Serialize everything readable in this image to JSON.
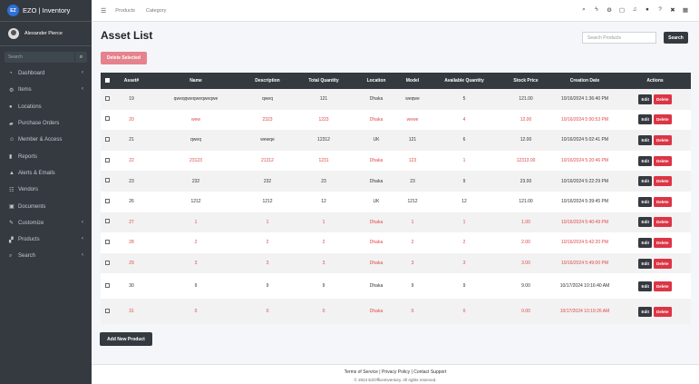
{
  "brand": {
    "logo": "EZ",
    "name": "EZO | Inventory"
  },
  "user": {
    "name": "Alexander Pierce"
  },
  "sidebar_search": {
    "placeholder": "Search"
  },
  "sidebar": {
    "items": [
      {
        "label": "Dashboard",
        "icon": "dashboard-icon",
        "glyph": "◔",
        "has_submenu": true
      },
      {
        "label": "Items",
        "icon": "items-icon",
        "glyph": "⚙",
        "has_submenu": true
      },
      {
        "label": "Locations",
        "icon": "location-pin-icon",
        "glyph": "●",
        "has_submenu": false
      },
      {
        "label": "Purchase Orders",
        "icon": "purchase-orders-icon",
        "glyph": "▰",
        "has_submenu": false
      },
      {
        "label": "Member & Access",
        "icon": "members-icon",
        "glyph": "☺",
        "has_submenu": false
      },
      {
        "label": "Reports",
        "icon": "reports-icon",
        "glyph": "▮",
        "has_submenu": false
      },
      {
        "label": "Alerts & Emails",
        "icon": "alert-icon",
        "glyph": "▲",
        "has_submenu": false
      },
      {
        "label": "Vendors",
        "icon": "vendors-icon",
        "glyph": "☷",
        "has_submenu": false
      },
      {
        "label": "Documents",
        "icon": "documents-icon",
        "glyph": "▣",
        "has_submenu": false
      },
      {
        "label": "Customize",
        "icon": "customize-icon",
        "glyph": "✎",
        "has_submenu": true
      },
      {
        "label": "Products",
        "icon": "products-icon",
        "glyph": "▞",
        "has_submenu": true
      },
      {
        "label": "Search",
        "icon": "search-icon",
        "glyph": "⌕",
        "has_submenu": true
      }
    ]
  },
  "topbar": {
    "links": [
      "Products",
      "Category"
    ]
  },
  "page": {
    "title": "Asset List",
    "search_placeholder": "Search Products",
    "search_button": "Search",
    "delete_selected": "Delete Selected",
    "add_new_product": "Add New Product"
  },
  "table": {
    "columns": [
      "Asset#",
      "Name",
      "Description",
      "Total Quantity",
      "Location",
      "Model",
      "Available Quantity",
      "Stock Price",
      "Creation Date",
      "Actions"
    ],
    "edit_label": "Edit",
    "delete_label": "Delete",
    "rows": [
      {
        "asset": "19",
        "name": "qweqqweqweqweqwe",
        "description": "qweq",
        "total_quantity": "121",
        "location": "Dhaka",
        "model": "weqwe",
        "available_quantity": "5",
        "stock_price": "121.00",
        "creation_date": "10/16/2024 1:36:40 PM",
        "highlight": false
      },
      {
        "asset": "20",
        "name": "wew",
        "description": "2323",
        "total_quantity": "1223",
        "location": "Dhaka",
        "model": "wewe",
        "available_quantity": "4",
        "stock_price": "12.00",
        "creation_date": "10/16/2024 5:00:53 PM",
        "highlight": true
      },
      {
        "asset": "21",
        "name": "qweq",
        "description": "wewqe",
        "total_quantity": "12312",
        "location": "UK",
        "model": "121",
        "available_quantity": "6",
        "stock_price": "12.00",
        "creation_date": "10/16/2024 5:02:41 PM",
        "highlight": false
      },
      {
        "asset": "22",
        "name": "23123",
        "description": "21312",
        "total_quantity": "1231",
        "location": "Dhaka",
        "model": "123",
        "available_quantity": "1",
        "stock_price": "12313.00",
        "creation_date": "10/16/2024 5:20:46 PM",
        "highlight": true
      },
      {
        "asset": "23",
        "name": "232",
        "description": "232",
        "total_quantity": "23",
        "location": "Dhaka",
        "model": "23",
        "available_quantity": "9",
        "stock_price": "23.00",
        "creation_date": "10/16/2024 5:22:29 PM",
        "highlight": false
      },
      {
        "asset": "26",
        "name": "1212",
        "description": "1212",
        "total_quantity": "12",
        "location": "UK",
        "model": "1212",
        "available_quantity": "12",
        "stock_price": "121.00",
        "creation_date": "10/16/2024 5:39:45 PM",
        "highlight": false
      },
      {
        "asset": "27",
        "name": "1",
        "description": "1",
        "total_quantity": "1",
        "location": "Dhaka",
        "model": "1",
        "available_quantity": "1",
        "stock_price": "1.00",
        "creation_date": "10/16/2024 5:40:49 PM",
        "highlight": true
      },
      {
        "asset": "28",
        "name": "2",
        "description": "2",
        "total_quantity": "2",
        "location": "Dhaka",
        "model": "2",
        "available_quantity": "2",
        "stock_price": "2.00",
        "creation_date": "10/16/2024 5:42:20 PM",
        "highlight": true
      },
      {
        "asset": "29",
        "name": "3",
        "description": "3",
        "total_quantity": "3",
        "location": "Dhaka",
        "model": "3",
        "available_quantity": "3",
        "stock_price": "3.00",
        "creation_date": "10/16/2024 5:49:00 PM",
        "highlight": true
      },
      {
        "asset": "30",
        "name": "9",
        "description": "9",
        "total_quantity": "9",
        "location": "Dhaka",
        "model": "9",
        "available_quantity": "9",
        "stock_price": "9.00",
        "creation_date": "10/17/2024 10:16:40 AM",
        "highlight": false
      },
      {
        "asset": "31",
        "name": "0",
        "description": "0",
        "total_quantity": "0",
        "location": "Dhaka",
        "model": "0",
        "available_quantity": "0",
        "stock_price": "0.00",
        "creation_date": "10/17/2024 10:19:26 AM",
        "highlight": true
      }
    ]
  },
  "footer": {
    "links": [
      "Terms of Service",
      "Privacy Policy",
      "Contact Support"
    ],
    "copyright": "© 2024 EZOfficeInventory. All rights reserved."
  },
  "colors": {
    "sidebar_bg": "#343a40",
    "accent_blue": "#2f6fd6",
    "danger": "#dc3545",
    "danger_light": "#e5828d",
    "highlight_text": "#e04848"
  }
}
